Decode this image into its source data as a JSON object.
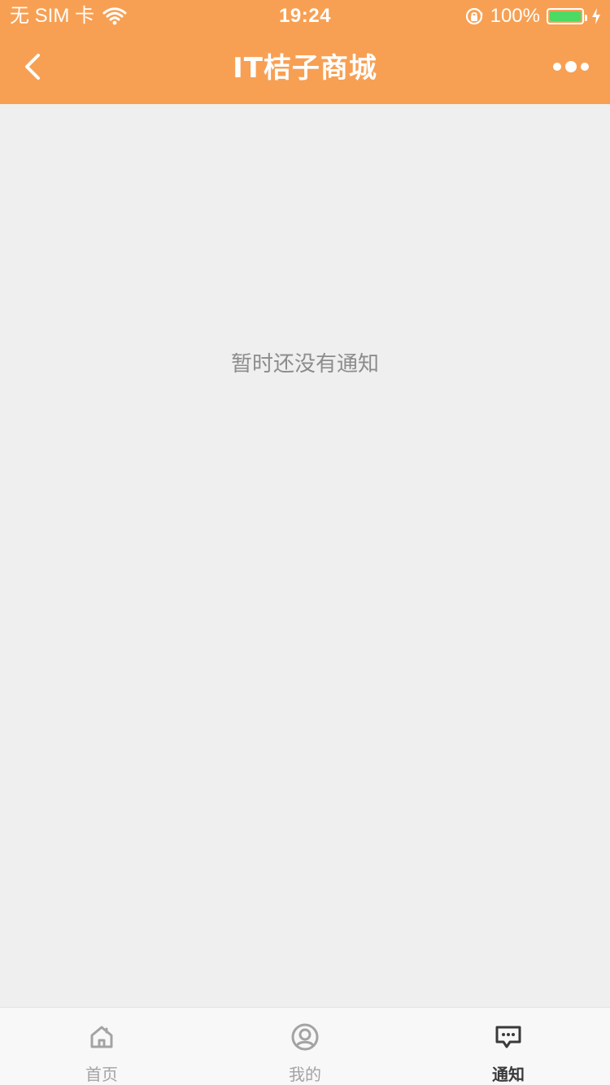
{
  "status_bar": {
    "carrier": "无 SIM 卡",
    "time": "19:24",
    "battery_percent_text": "100%",
    "battery_level": 1.0,
    "colors": {
      "battery_fill": "#4cd964"
    }
  },
  "navbar": {
    "title": "IT桔子商城",
    "icons": {
      "back": "chevron-left-icon",
      "more": "more-horizontal-icon"
    },
    "colors": {
      "background": "#f7a053",
      "foreground": "#ffffff"
    }
  },
  "main": {
    "empty_message": "暂时还没有通知",
    "colors": {
      "background": "#efefef",
      "text": "#8c8c8c"
    }
  },
  "tabbar": {
    "tabs": [
      {
        "label": "首页",
        "icon": "home-icon",
        "active": false
      },
      {
        "label": "我的",
        "icon": "user-circle-icon",
        "active": false
      },
      {
        "label": "通知",
        "icon": "message-icon",
        "active": true
      }
    ],
    "colors": {
      "inactive": "#a3a3a3",
      "active": "#3a3a3a",
      "background": "#f8f8f8"
    }
  }
}
